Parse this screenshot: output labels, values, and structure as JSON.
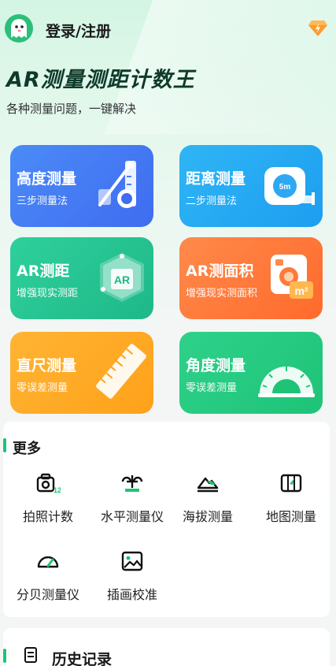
{
  "header": {
    "login_label": "登录/注册",
    "avatar_icon": "ghost-avatar-icon",
    "vip_icon": "diamond-vip-icon",
    "accent": "#2bbf7a"
  },
  "hero": {
    "title": "AR测量测距计数王",
    "subtitle": "各种测量问题，一键解决"
  },
  "cards": [
    {
      "title": "高度测量",
      "desc": "三步测量法",
      "icon": "height-ruler-icon",
      "color": "#4b8bf7"
    },
    {
      "title": "距离测量",
      "desc": "二步测量法",
      "icon": "tape-measure-icon",
      "color": "#2fb5f5"
    },
    {
      "title": "AR测距",
      "desc": "增强现实测距",
      "icon": "ar-cube-icon",
      "color": "#2fd09c"
    },
    {
      "title": "AR测面积",
      "desc": "增强现实测面积",
      "icon": "area-m2-icon",
      "color": "#ff8a4a"
    },
    {
      "title": "直尺测量",
      "desc": "零误差测量",
      "icon": "ruler-icon",
      "color": "#ffb433"
    },
    {
      "title": "角度测量",
      "desc": "零误差测量",
      "icon": "protractor-icon",
      "color": "#2fd18a"
    }
  ],
  "more": {
    "title": "更多",
    "tools": [
      {
        "label": "拍照计数",
        "icon": "camera-count-icon"
      },
      {
        "label": "水平测量仪",
        "icon": "level-icon"
      },
      {
        "label": "海拔测量",
        "icon": "mountain-icon"
      },
      {
        "label": "地图测量",
        "icon": "map-icon"
      },
      {
        "label": "分贝测量仪",
        "icon": "decibel-gauge-icon"
      },
      {
        "label": "插画校准",
        "icon": "image-icon"
      }
    ]
  },
  "history": {
    "title": "历史记录",
    "icon": "history-list-icon"
  }
}
